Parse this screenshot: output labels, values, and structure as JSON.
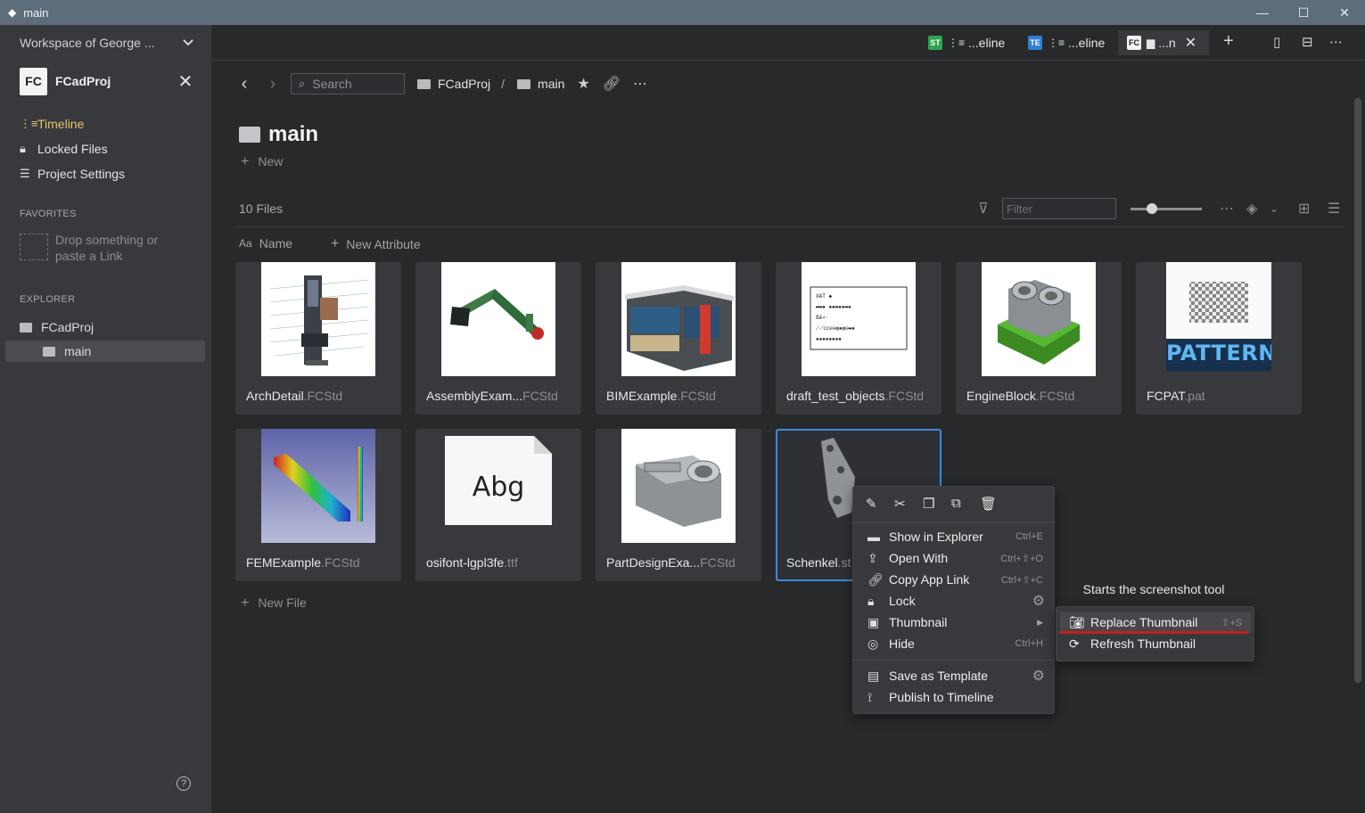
{
  "window": {
    "title": "main",
    "minimize": "—",
    "maximize": "☐",
    "close": "✕"
  },
  "sidebar": {
    "workspace": "Workspace of George ...",
    "project": {
      "logo": "FC",
      "name": "FCadProj"
    },
    "nav": [
      {
        "label": "Timeline",
        "icon": "timeline-icon"
      },
      {
        "label": "Locked Files",
        "icon": "lock-icon"
      },
      {
        "label": "Project Settings",
        "icon": "settings-icon"
      }
    ],
    "favorites_title": "FAVORITES",
    "favorites_hint_1": "Drop something or",
    "favorites_hint_2": "paste a Link",
    "explorer_title": "EXPLORER",
    "tree": [
      {
        "label": "FCadProj"
      },
      {
        "label": "main"
      }
    ]
  },
  "tabs": [
    {
      "badge": "ST",
      "label": "...eline",
      "color": "#2da44e"
    },
    {
      "badge": "TE",
      "label": "...eline",
      "color": "#2f7fd6"
    },
    {
      "badge": "FC",
      "label": "...n",
      "color": "#f3f3f3"
    }
  ],
  "toolbar": {
    "search_placeholder": "Search",
    "crumbs": [
      "FCadProj",
      "main"
    ],
    "crumb_sep": "/"
  },
  "page": {
    "title": "main",
    "new_label": "New",
    "files_count": "10 Files",
    "filter_placeholder": "Filter",
    "col_name": "Name",
    "col_new_attr": "New Attribute",
    "new_file": "New File"
  },
  "files": [
    {
      "name": "ArchDetail",
      "ext": ".FCStd"
    },
    {
      "name": "AssemblyExam...",
      "ext": "FCStd"
    },
    {
      "name": "BIMExample",
      "ext": ".FCStd"
    },
    {
      "name": "draft_test_objects",
      "ext": ".FCStd"
    },
    {
      "name": "EngineBlock",
      "ext": ".FCStd"
    },
    {
      "name": "FCPAT",
      "ext": ".pat"
    },
    {
      "name": "FEMExample",
      "ext": ".FCStd"
    },
    {
      "name": "osifont-lgpl3fe",
      "ext": ".ttf"
    },
    {
      "name": "PartDesignExa...",
      "ext": "FCStd"
    },
    {
      "name": "Schenkel",
      "ext": ".st"
    }
  ],
  "thumb_text": {
    "pattern": "PATTERN",
    "font_sample": "Abg"
  },
  "context_menu": {
    "items": [
      {
        "label": "Show in Explorer",
        "shortcut": "Ctrl+E"
      },
      {
        "label": "Open With",
        "shortcut": "Ctrl+⇧+O"
      },
      {
        "label": "Copy App Link",
        "shortcut": "Ctrl+⇧+C"
      },
      {
        "label": "Lock",
        "shortcut": ""
      },
      {
        "label": "Thumbnail",
        "shortcut": ""
      },
      {
        "label": "Hide",
        "shortcut": "Ctrl+H"
      },
      {
        "label": "Save as Template",
        "shortcut": ""
      },
      {
        "label": "Publish to Timeline",
        "shortcut": ""
      }
    ]
  },
  "tooltip": "Starts the screenshot tool",
  "submenu": [
    {
      "label": "Replace Thumbnail",
      "shortcut": "⇧+S"
    },
    {
      "label": "Refresh Thumbnail",
      "shortcut": ""
    }
  ]
}
